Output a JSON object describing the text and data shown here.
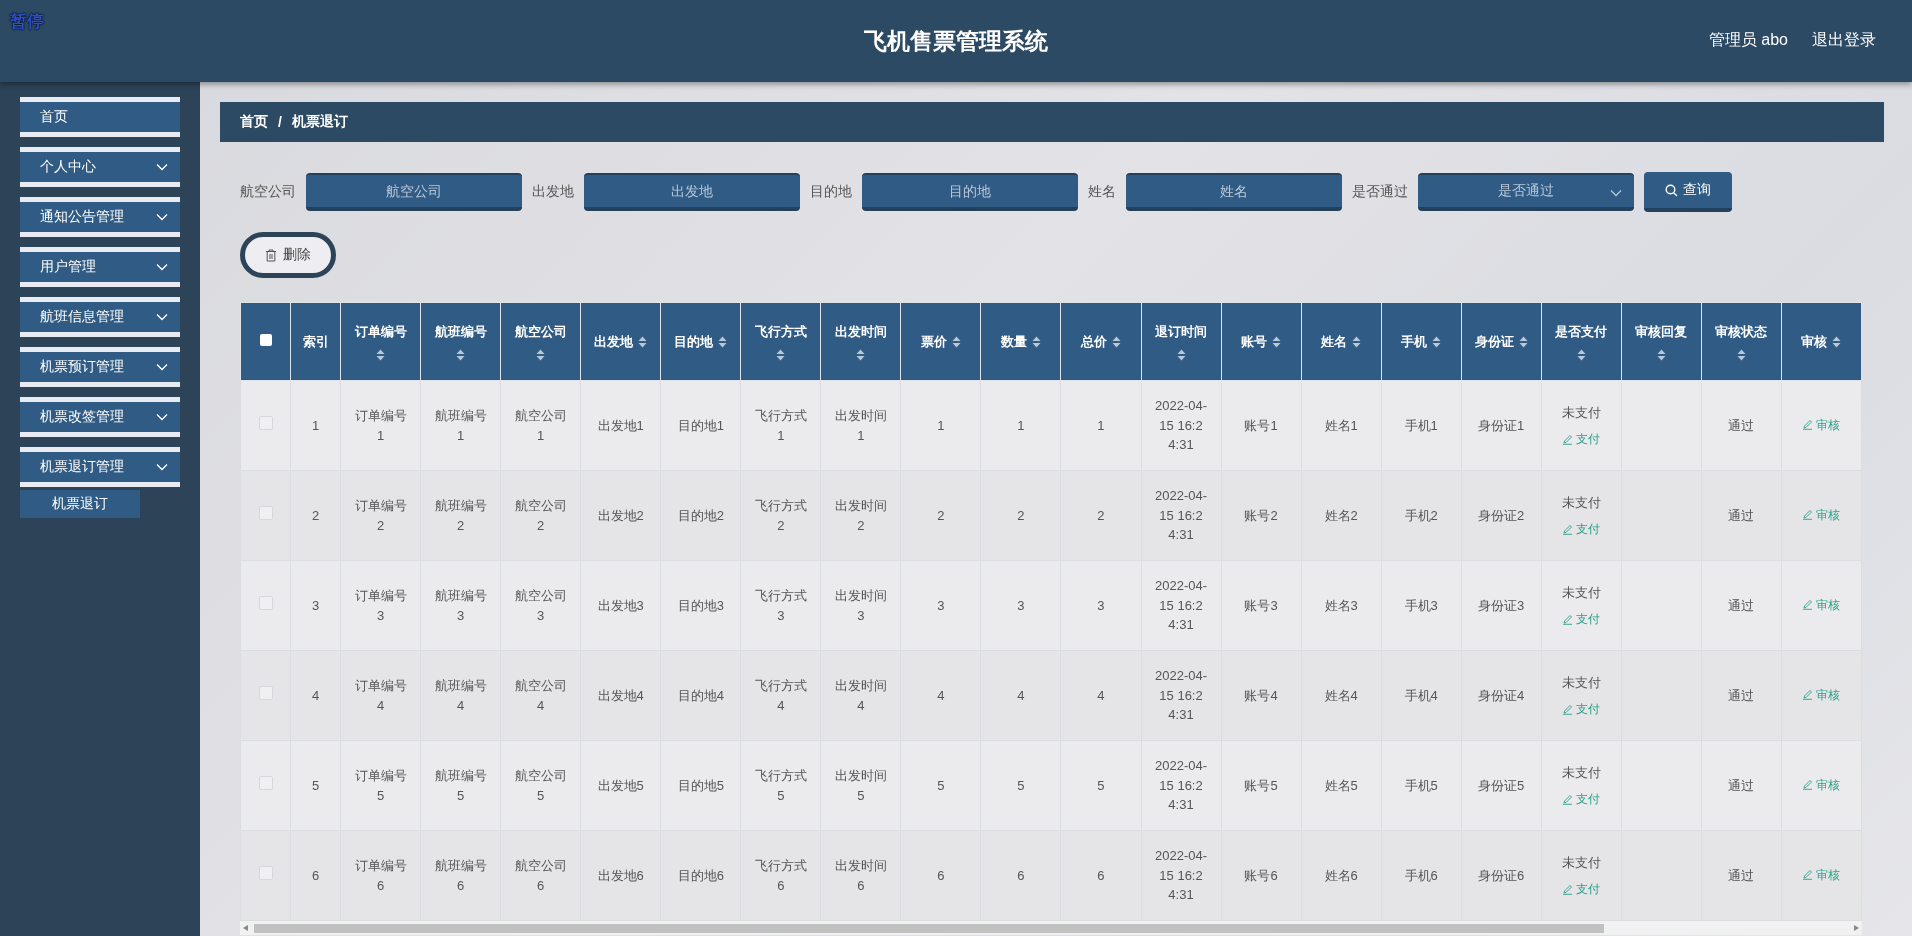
{
  "overlay_label": "暂停",
  "header": {
    "title": "飞机售票管理系统",
    "user": "管理员 abo",
    "logout": "退出登录"
  },
  "sidebar": {
    "items": [
      {
        "label": "首页",
        "expandable": false
      },
      {
        "label": "个人中心",
        "expandable": true
      },
      {
        "label": "通知公告管理",
        "expandable": true
      },
      {
        "label": "用户管理",
        "expandable": true
      },
      {
        "label": "航班信息管理",
        "expandable": true
      },
      {
        "label": "机票预订管理",
        "expandable": true
      },
      {
        "label": "机票改签管理",
        "expandable": true
      },
      {
        "label": "机票退订管理",
        "expandable": true,
        "children": [
          {
            "label": "机票退订"
          }
        ]
      }
    ]
  },
  "breadcrumb": [
    "首页",
    "机票退订"
  ],
  "breadcrumb_separator": "/",
  "filters": [
    {
      "kind": "input",
      "label": "航空公司",
      "placeholder": "航空公司"
    },
    {
      "kind": "input",
      "label": "出发地",
      "placeholder": "出发地"
    },
    {
      "kind": "input",
      "label": "目的地",
      "placeholder": "目的地"
    },
    {
      "kind": "input",
      "label": "姓名",
      "placeholder": "姓名"
    },
    {
      "kind": "select",
      "label": "是否通过",
      "placeholder": "是否通过"
    }
  ],
  "search_button": "查询",
  "delete_button": "删除",
  "table": {
    "select_all_checked": false,
    "columns": [
      {
        "label": "索引",
        "sortable": false
      },
      {
        "label": "订单编号",
        "sortable": true
      },
      {
        "label": "航班编号",
        "sortable": true
      },
      {
        "label": "航空公司",
        "sortable": true
      },
      {
        "label": "出发地",
        "sortable": true
      },
      {
        "label": "目的地",
        "sortable": true
      },
      {
        "label": "飞行方式",
        "sortable": true
      },
      {
        "label": "出发时间",
        "sortable": true
      },
      {
        "label": "票价",
        "sortable": true
      },
      {
        "label": "数量",
        "sortable": true
      },
      {
        "label": "总价",
        "sortable": true
      },
      {
        "label": "退订时间",
        "sortable": true
      },
      {
        "label": "账号",
        "sortable": true
      },
      {
        "label": "姓名",
        "sortable": true
      },
      {
        "label": "手机",
        "sortable": true
      },
      {
        "label": "身份证",
        "sortable": true
      },
      {
        "label": "是否支付",
        "sortable": true
      },
      {
        "label": "审核回复",
        "sortable": true
      },
      {
        "label": "审核状态",
        "sortable": true
      },
      {
        "label": "审核",
        "sortable": true
      }
    ],
    "rows": [
      {
        "checked": false,
        "cells": [
          "1",
          "订单编号1",
          "航班编号1",
          "航空公司1",
          "出发地1",
          "目的地1",
          "飞行方式1",
          "出发时间1",
          "1",
          "1",
          "1",
          "2022-04-15 16:24:31",
          "账号1",
          "姓名1",
          "手机1",
          "身份证1"
        ],
        "payment_status": "未支付",
        "pay_action": "支付",
        "review_status": "通过",
        "review_action": "审核"
      },
      {
        "checked": false,
        "cells": [
          "2",
          "订单编号2",
          "航班编号2",
          "航空公司2",
          "出发地2",
          "目的地2",
          "飞行方式2",
          "出发时间2",
          "2",
          "2",
          "2",
          "2022-04-15 16:24:31",
          "账号2",
          "姓名2",
          "手机2",
          "身份证2"
        ],
        "payment_status": "未支付",
        "pay_action": "支付",
        "review_status": "通过",
        "review_action": "审核"
      },
      {
        "checked": false,
        "cells": [
          "3",
          "订单编号3",
          "航班编号3",
          "航空公司3",
          "出发地3",
          "目的地3",
          "飞行方式3",
          "出发时间3",
          "3",
          "3",
          "3",
          "2022-04-15 16:24:31",
          "账号3",
          "姓名3",
          "手机3",
          "身份证3"
        ],
        "payment_status": "未支付",
        "pay_action": "支付",
        "review_status": "通过",
        "review_action": "审核"
      },
      {
        "checked": false,
        "cells": [
          "4",
          "订单编号4",
          "航班编号4",
          "航空公司4",
          "出发地4",
          "目的地4",
          "飞行方式4",
          "出发时间4",
          "4",
          "4",
          "4",
          "2022-04-15 16:24:31",
          "账号4",
          "姓名4",
          "手机4",
          "身份证4"
        ],
        "payment_status": "未支付",
        "pay_action": "支付",
        "review_status": "通过",
        "review_action": "审核"
      },
      {
        "checked": false,
        "cells": [
          "5",
          "订单编号5",
          "航班编号5",
          "航空公司5",
          "出发地5",
          "目的地5",
          "飞行方式5",
          "出发时间5",
          "5",
          "5",
          "5",
          "2022-04-15 16:24:31",
          "账号5",
          "姓名5",
          "手机5",
          "身份证5"
        ],
        "payment_status": "未支付",
        "pay_action": "支付",
        "review_status": "通过",
        "review_action": "审核"
      },
      {
        "checked": false,
        "cells": [
          "6",
          "订单编号6",
          "航班编号6",
          "航空公司6",
          "出发地6",
          "目的地6",
          "飞行方式6",
          "出发时间6",
          "6",
          "6",
          "6",
          "2022-04-15 16:24:31",
          "账号6",
          "姓名6",
          "手机6",
          "身份证6"
        ],
        "payment_status": "未支付",
        "pay_action": "支付",
        "review_status": "通过",
        "review_action": "审核"
      }
    ]
  }
}
